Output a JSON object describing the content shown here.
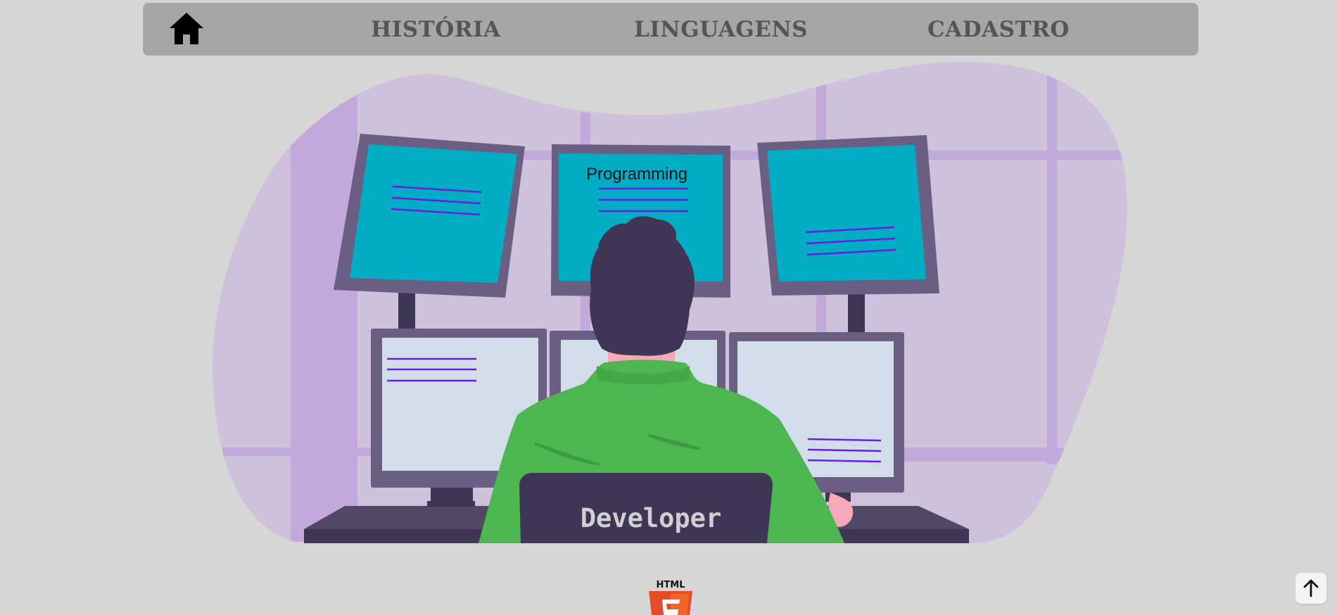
{
  "nav": {
    "home_icon": "home-icon",
    "items": [
      {
        "label": "HISTÓRIA"
      },
      {
        "label": "LINGUAGENS"
      },
      {
        "label": "CADASTRO"
      }
    ]
  },
  "hero": {
    "illustration": "developer-at-monitors",
    "monitor_title": "Programming",
    "chair_label": "Developer"
  },
  "footer": {
    "logo_text": "HTML",
    "logo_icon": "html5-logo"
  },
  "scroll_top": {
    "icon": "arrow-up-icon"
  },
  "colors": {
    "background": "#d6d6d6",
    "navbar": "#a6a6a6",
    "nav_text": "#555555",
    "blob": "#cfc1dc",
    "blob_grid": "#c2a9dc",
    "screen_teal": "#00adc4",
    "screen_light": "#d3ddea",
    "shirt": "#4db651",
    "hair": "#3f3656",
    "accent_lines": "#6a1de0"
  }
}
